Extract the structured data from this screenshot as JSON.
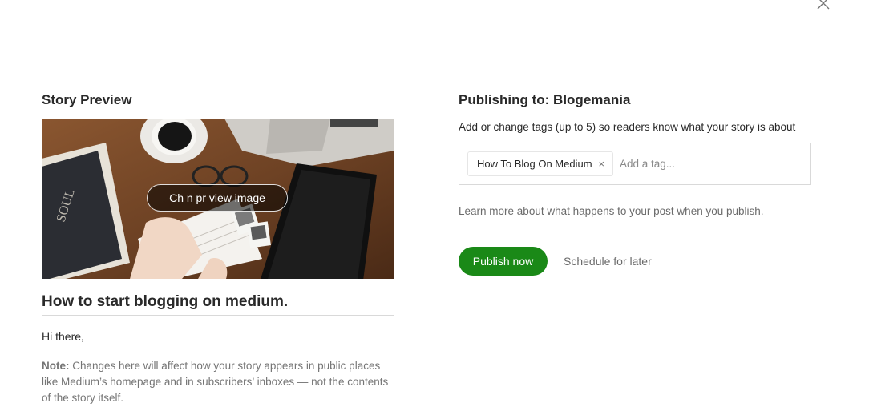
{
  "close": {
    "icon": "close-icon"
  },
  "preview": {
    "section_title": "Story Preview",
    "change_image_label": "Ch  n    pr  view image",
    "title": "How to start blogging on medium.",
    "subtitle": "Hi there,",
    "note_label": "Note:",
    "note_text": " Changes here will affect how your story appears in public places like Medium’s homepage and in subscribers’ inboxes — not the contents of the story itself."
  },
  "publish": {
    "heading_prefix": "Publishing to: ",
    "publication": "Blogemania",
    "tags_hint": "Add or change tags (up to 5) so readers know what your story is about",
    "tags": [
      {
        "label": "How To Blog On Medium",
        "remove": "×"
      }
    ],
    "tag_placeholder": "Add a tag...",
    "learn_more_link": "Learn more",
    "learn_more_text": " about what happens to your post when you publish.",
    "publish_now_label": "Publish now",
    "schedule_label": "Schedule for later"
  },
  "colors": {
    "accent_green": "#1a8917",
    "text_primary": "#292929",
    "text_muted": "#757575",
    "border": "#d9d9d9"
  }
}
